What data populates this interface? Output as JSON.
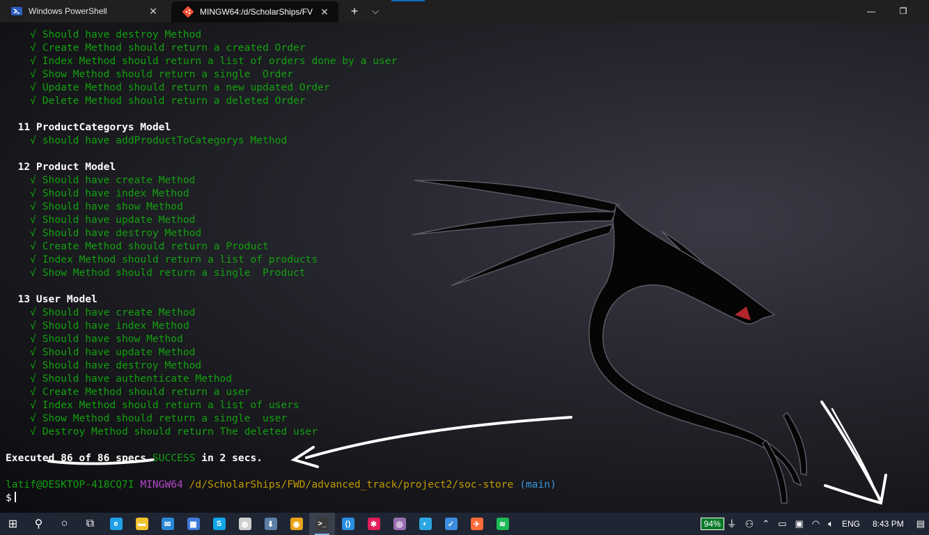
{
  "titlebar": {
    "tabs": [
      {
        "title": "Windows PowerShell",
        "icon": "powershell-icon",
        "active": false
      },
      {
        "title": "MINGW64:/d/ScholarShips/FV",
        "icon": "git-bash-icon",
        "active": true
      }
    ],
    "new_tab": "+",
    "dropdown": "⌵",
    "close_glyph": "✕",
    "minimize_glyph": "—",
    "maximize_glyph": "❐"
  },
  "terminal": {
    "check_glyph": "√",
    "lines": [
      {
        "type": "pass",
        "text": "Should have destroy Method"
      },
      {
        "type": "pass",
        "text": "Create Method should return a created Order"
      },
      {
        "type": "pass",
        "text": "Index Method should return a list of orders done by a user"
      },
      {
        "type": "pass",
        "text": "Show Method should return a single  Order"
      },
      {
        "type": "pass",
        "text": "Update Method should return a new updated Order"
      },
      {
        "type": "pass",
        "text": "Delete Method should return a deleted Order"
      },
      {
        "type": "blank",
        "text": ""
      },
      {
        "type": "heading",
        "text": "11 ProductCategorys Model"
      },
      {
        "type": "pass",
        "text": "should have addProductToCategorys Method"
      },
      {
        "type": "blank",
        "text": ""
      },
      {
        "type": "heading",
        "text": "12 Product Model"
      },
      {
        "type": "pass",
        "text": "Should have create Method"
      },
      {
        "type": "pass",
        "text": "Should have index Method"
      },
      {
        "type": "pass",
        "text": "Should have show Method"
      },
      {
        "type": "pass",
        "text": "Should have update Method"
      },
      {
        "type": "pass",
        "text": "Should have destroy Method"
      },
      {
        "type": "pass",
        "text": "Create Method should return a Product"
      },
      {
        "type": "pass",
        "text": "Index Method should return a list of products"
      },
      {
        "type": "pass",
        "text": "Show Method should return a single  Product"
      },
      {
        "type": "blank",
        "text": ""
      },
      {
        "type": "heading",
        "text": "13 User Model"
      },
      {
        "type": "pass",
        "text": "Should have create Method"
      },
      {
        "type": "pass",
        "text": "Should have index Method"
      },
      {
        "type": "pass",
        "text": "Should have show Method"
      },
      {
        "type": "pass",
        "text": "Should have update Method"
      },
      {
        "type": "pass",
        "text": "Should have destroy Method"
      },
      {
        "type": "pass",
        "text": "Should have authenticate Method"
      },
      {
        "type": "pass",
        "text": "Create Method should return a user"
      },
      {
        "type": "pass",
        "text": "Index Method should return a list of users"
      },
      {
        "type": "pass",
        "text": "Show Method should return a single  user"
      },
      {
        "type": "pass",
        "text": "Destroy Method should return The deleted user"
      },
      {
        "type": "blank",
        "text": ""
      }
    ],
    "summary": {
      "prefix": "Executed ",
      "count": "86 of 86 specs",
      "status": "SUCCESS",
      "suffix": " in 2 secs."
    },
    "prompt": {
      "user": "latif@DESKTOP-418CQ7I",
      "env": "MINGW64",
      "path": "/d/ScholarShips/FWD/advanced_track/project2/soc-store",
      "branch": "(main)",
      "symbol": "$"
    }
  },
  "taskbar": {
    "apps": [
      {
        "name": "windows-start-icon",
        "glyph": "⊞",
        "color": "#ffffff"
      },
      {
        "name": "search-icon",
        "glyph": "⚲",
        "color": "#ffffff"
      },
      {
        "name": "cortana-icon",
        "glyph": "○",
        "color": "#ffffff"
      },
      {
        "name": "task-view-icon",
        "glyph": "⧉",
        "color": "#ffffff"
      },
      {
        "name": "edge-icon",
        "glyph": "e",
        "color": "#1fa0e8"
      },
      {
        "name": "file-explorer-icon",
        "glyph": "▬",
        "color": "#f2c12e"
      },
      {
        "name": "mail-icon",
        "glyph": "✉",
        "color": "#2b88d8"
      },
      {
        "name": "store-icon",
        "glyph": "▦",
        "color": "#3d7bd6"
      },
      {
        "name": "skype-icon",
        "glyph": "S",
        "color": "#0fa5e9"
      },
      {
        "name": "app-icon",
        "glyph": "◍",
        "color": "#cfcfcf"
      },
      {
        "name": "inbox-icon",
        "glyph": "⬇",
        "color": "#5b7fa8"
      },
      {
        "name": "chrome-icon",
        "glyph": "◉",
        "color": "#e8a21a"
      },
      {
        "name": "terminal-icon",
        "glyph": ">_",
        "color": "#3a3a3a"
      },
      {
        "name": "vscode-icon",
        "glyph": "⟨⟩",
        "color": "#2a8ee0"
      },
      {
        "name": "slack-icon",
        "glyph": "✱",
        "color": "#e01e5a"
      },
      {
        "name": "obs-icon",
        "glyph": "◎",
        "color": "#9a6fb0"
      },
      {
        "name": "app2-icon",
        "glyph": "◐",
        "color": "#2ca6e0"
      },
      {
        "name": "todo-icon",
        "glyph": "✓",
        "color": "#3b8de0"
      },
      {
        "name": "postman-icon",
        "glyph": "✈",
        "color": "#ff6c37"
      },
      {
        "name": "spotify-icon",
        "glyph": "≋",
        "color": "#1db954"
      }
    ],
    "active_app_index": 12,
    "tray": {
      "battery": "94%",
      "language": "ENG",
      "time": "8:43 PM"
    }
  }
}
